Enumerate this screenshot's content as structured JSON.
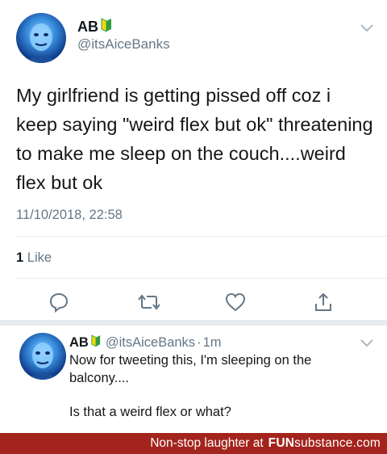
{
  "tweet": {
    "display_name": "AB",
    "handle": "@itsAiceBanks",
    "text": "My girlfriend is getting pissed off coz i keep saying \"weird flex but ok\" threatening to make me sleep on the couch....weird flex but ok",
    "timestamp": "11/10/2018, 22:58",
    "likes_count": "1",
    "likes_label": "Like"
  },
  "reply": {
    "display_name": "AB",
    "handle": "@itsAiceBanks",
    "separator": "·",
    "time": "1m",
    "line1": "Now for tweeting this, I'm sleeping on the balcony....",
    "line2": "Is that a weird flex or what?"
  },
  "footer": {
    "tagline": "Non-stop laughter at",
    "brand_fun": "FUN",
    "brand_sub": "substance",
    "brand_tld": ".com"
  },
  "colors": {
    "text": "#14171a",
    "secondary": "#657786",
    "divider": "#e1e8ed",
    "footer_bg": "#a3241c",
    "badge_green": "#2f9e44",
    "badge_yellow": "#f5d90a"
  },
  "icons": [
    "chevron-down-icon",
    "reply-icon",
    "retweet-icon",
    "heart-icon",
    "share-icon",
    "beginner-badge-icon"
  ]
}
